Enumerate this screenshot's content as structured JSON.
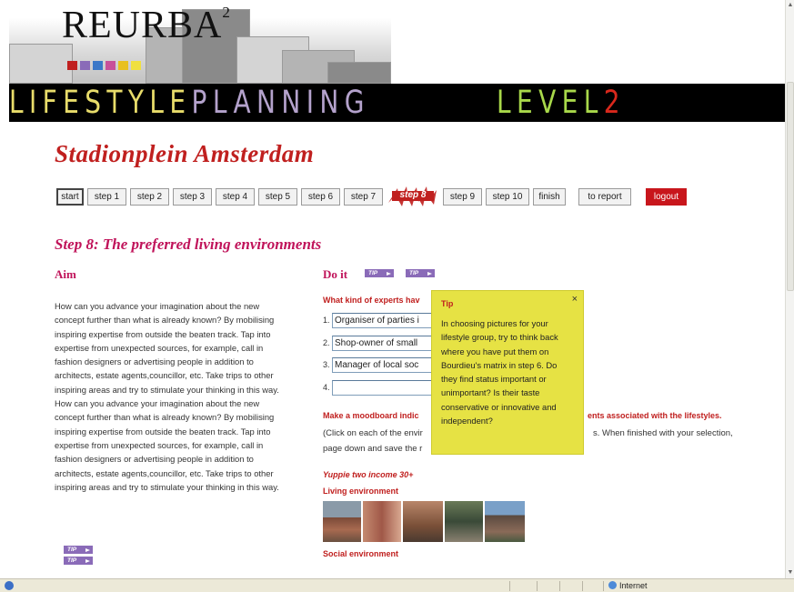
{
  "header": {
    "logo_text": "REURBA",
    "logo_superscript": "2",
    "banner_lifestyle": "LIFESTYLE",
    "banner_planning": "PLANNING",
    "banner_level": "LEVEL",
    "banner_level_number": "2"
  },
  "site_title": "Stadionplein Amsterdam",
  "nav": {
    "steps": [
      "start",
      "step 1",
      "step 2",
      "step 3",
      "step 4",
      "step 5",
      "step 6",
      "step 7",
      "step 8",
      "step 9",
      "step 10",
      "finish"
    ],
    "active_step": "step 8",
    "to_report": "to report",
    "logout": "logout"
  },
  "step_title": "Step 8: The preferred living environments",
  "aim": {
    "heading": "Aim",
    "text": "How can you advance your imagination about the new concept further than what is already known? By mobilising inspiring expertise from outside the beaten track. Tap into expertise from unexpected sources, for example, call in fashion designers or advertising people in addition to architects, estate agents,councillor, etc. Take trips to other inspiring areas and try to stimulate your thinking in this way. How can you advance your imagination about the new concept further than what is already known? By mobilising inspiring expertise from outside the beaten track. Tap into expertise from unexpected sources, for example, call in fashion designers or advertising people in addition to architects, estate agents,councillor, etc. Take trips to other inspiring areas and try to stimulate your thinking in this way.",
    "tip_label": "TIP"
  },
  "doit": {
    "heading": "Do it",
    "tip_label": "TIP",
    "question": "What kind of experts hav",
    "answers": [
      {
        "num": "1.",
        "value": "Organiser of parties i"
      },
      {
        "num": "2.",
        "value": "Shop-owner of small"
      },
      {
        "num": "3.",
        "value": "Manager of local soc"
      },
      {
        "num": "4.",
        "value": ""
      }
    ],
    "moodboard_q_start": "Make a moodboard indic",
    "moodboard_q_end": "ents associated with the lifestyles.",
    "instruction_start": "(Click on each of the envir",
    "instruction_end": "s. When finished with your selection,",
    "instruction_line2": "page down and save the r",
    "group_label": "Yuppie two income 30+",
    "living_label": "Living environment",
    "social_label": "Social environment"
  },
  "tip": {
    "title": "Tip",
    "close": "×",
    "text": "In choosing pictures for your lifestyle group, try to think back where you have put them on Bourdieu's matrix in step 6. Do they find status important or unimportant? Is their taste conservative or innovative and independent?"
  },
  "status": {
    "zone": "Internet"
  },
  "colors": {
    "accent_red": "#c0201f",
    "accent_magenta": "#c0135a",
    "tip_yellow": "#e6e244",
    "tip_button": "#8a6bb8",
    "logout_red": "#c8161c"
  }
}
